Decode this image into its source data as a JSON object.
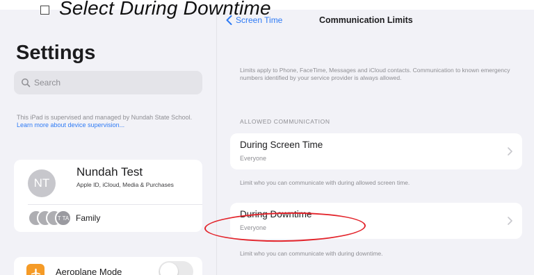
{
  "caption": {
    "instruction": "Select During Downtime"
  },
  "left_pane": {
    "title": "Settings",
    "search": {
      "placeholder": "Search",
      "icon": "search-icon"
    },
    "supervision": {
      "text": "This iPad is supervised and managed by Nundah State School.",
      "link": "Learn more about device supervision..."
    },
    "profile": {
      "initials": "NT",
      "name": "Nundah Test",
      "subtitle": "Apple ID, iCloud, Media & Purchases"
    },
    "family": {
      "mini_avatar_last": "T TA",
      "label": "Family"
    },
    "aeroplane": {
      "label": "Aeroplane Mode",
      "icon": "airplane-icon",
      "toggle_on": false
    }
  },
  "right_pane": {
    "back_label": "Screen Time",
    "title": "Communication Limits",
    "description": "Limits apply to Phone, FaceTime, Messages and iCloud contacts. Communication to known emergency numbers identified by your service provider is always allowed.",
    "section_header": "ALLOWED COMMUNICATION",
    "rows": [
      {
        "title": "During Screen Time",
        "value": "Everyone",
        "footnote": "Limit who you can communicate with during allowed screen time."
      },
      {
        "title": "During Downtime",
        "value": "Everyone",
        "footnote": "Limit who you can communicate with during downtime."
      }
    ]
  },
  "colors": {
    "accent_blue": "#2f7bf5",
    "annotation_red": "#e3242b",
    "aeroplane_orange": "#f59b27"
  }
}
